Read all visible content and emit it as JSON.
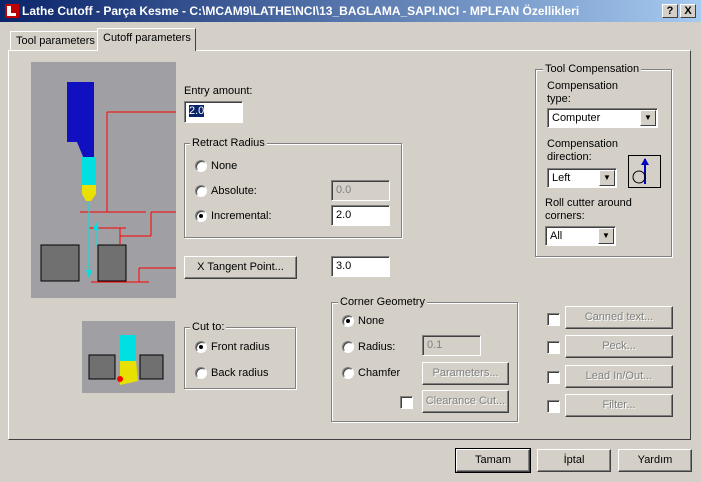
{
  "window": {
    "title": "Lathe Cutoff - Parça Kesme - C:\\MCAM9\\LATHE\\NCI\\13_BAGLAMA_SAPI.NCI - MPLFAN Özellikleri",
    "help_btn": "?",
    "close_btn": "X"
  },
  "tabs": [
    {
      "label": "Tool parameters"
    },
    {
      "label": "Cutoff parameters"
    }
  ],
  "entry": {
    "label": "Entry amount:",
    "value": "2.0"
  },
  "retract": {
    "title": "Retract Radius",
    "none": "None",
    "absolute": "Absolute:",
    "absolute_value": "0.0",
    "incremental": "Incremental:",
    "incremental_value": "2.0",
    "selected": "Incremental"
  },
  "tangent": {
    "button": "X Tangent Point...",
    "value": "3.0"
  },
  "cut_to": {
    "title": "Cut to:",
    "front": "Front radius",
    "back": "Back radius",
    "selected": "Front radius"
  },
  "corner": {
    "title": "Corner Geometry",
    "none": "None",
    "radius": "Radius:",
    "radius_value": "0.1",
    "chamfer": "Chamfer",
    "parameters_btn": "Parameters...",
    "clearance_btn": "Clearance Cut...",
    "selected": "None"
  },
  "comp": {
    "title": "Tool Compensation",
    "type_label": "Compensation type:",
    "type_value": "Computer",
    "direction_label": "Compensation direction:",
    "direction_value": "Left",
    "roll_label": "Roll cutter around corners:",
    "roll_value": "All"
  },
  "options": [
    {
      "label": "Canned text..."
    },
    {
      "label": "Peck..."
    },
    {
      "label": "Lead In/Out..."
    },
    {
      "label": "Filter..."
    }
  ],
  "footer": {
    "ok": "Tamam",
    "cancel": "İptal",
    "help": "Yardım"
  }
}
